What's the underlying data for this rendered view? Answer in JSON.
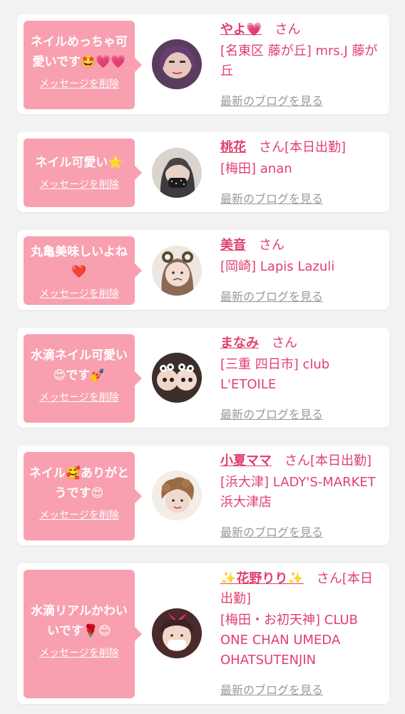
{
  "messages": [
    {
      "text": "ネイルめっちゃ可愛いです🤩💗💗",
      "delete_label": "メッセージを削除",
      "name": "やよ💗",
      "suffix": "さん",
      "shop": "[名東区 藤が丘] mrs.J 藤が丘",
      "blog_label": "最新のブログを見る"
    },
    {
      "text": "ネイル可愛い⭐",
      "delete_label": "メッセージを削除",
      "name": "桃花",
      "suffix": "さん[本日出勤]",
      "shop": "[梅田] anan",
      "blog_label": "最新のブログを見る"
    },
    {
      "text": "丸亀美味しいよね❤️",
      "delete_label": "メッセージを削除",
      "name": "美音",
      "suffix": "さん",
      "shop": "[岡崎] Lapis Lazuli",
      "blog_label": "最新のブログを見る"
    },
    {
      "text": "水滴ネイル可愛い😍です💅",
      "delete_label": "メッセージを削除",
      "name": "まなみ",
      "suffix": "さん",
      "shop": "[三重 四日市] club L'ETOILE",
      "blog_label": "最新のブログを見る"
    },
    {
      "text": "ネイル🥰ありがとうです😍",
      "delete_label": "メッセージを削除",
      "name": "小夏ママ",
      "suffix": "さん[本日出勤]",
      "shop": "[浜大津] LADY'S-MARKET 浜大津店",
      "blog_label": "最新のブログを見る"
    },
    {
      "text": "水滴リアルかわいいです🌹😊",
      "delete_label": "メッセージを削除",
      "name": "✨花野りり✨",
      "suffix": "さん[本日出勤]",
      "shop": "[梅田・お初天神] CLUB ONE CHAN UMEDA OHATSUTENJIN",
      "blog_label": "最新のブログを見る"
    }
  ],
  "colors": {
    "accent": "#e0406e",
    "bubble": "#f8a0b0",
    "link_gray": "#9a9a9a",
    "background": "#f2f2f2"
  }
}
